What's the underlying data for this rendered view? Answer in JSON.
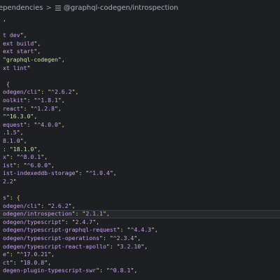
{
  "breadcrumb": {
    "first": "ependencies",
    "separator": ">",
    "second": "@graphql-codegen/introspection",
    "second_icon": "list-icon"
  },
  "code_lines": [
    {
      "text": ","
    },
    {
      "text": ""
    },
    {
      "text": "t dev\","
    },
    {
      "text": "ext build\","
    },
    {
      "text": "ext start\","
    },
    {
      "text": "\"graphql-codegen\","
    },
    {
      "text": "xt lint\""
    },
    {
      "text": ""
    },
    {
      "text": " {"
    },
    {
      "text": "odegen/cli\": \"^2.6.2\","
    },
    {
      "text": "oolkit\": \"^1.8.1\","
    },
    {
      "text": "react\": \"^1.2.8\","
    },
    {
      "text": "\"^16.3.0\","
    },
    {
      "text": "equest\": \"^4.0.0\","
    },
    {
      "text": ".1.5\","
    },
    {
      "text": "8.1.0\","
    },
    {
      "text": ": \"18.1.0\","
    },
    {
      "text": "x\": \"^8.0.1\","
    },
    {
      "text": "ist\": \"^6.0.0\","
    },
    {
      "text": "ist-indexeddb-storage\": \"^1.0.4\","
    },
    {
      "text": "2.2\""
    },
    {
      "text": ""
    },
    {
      "text": "s\": {"
    },
    {
      "text": "odegen/cli\": \"2.6.2\","
    },
    {
      "text": "odegen/introspection\": \"2.1.1\","
    },
    {
      "text": "odegen/typescript\": \"2.4.7\","
    },
    {
      "text": "odegen/typescript-graphql-request\": \"^4.4.3\","
    },
    {
      "text": "odegen/typescript-operations\": \"^2.3.4\","
    },
    {
      "text": "odegen/typescript-react-apollo\": \"3.2.10\","
    },
    {
      "text": "e\": \"^17.0.21\","
    },
    {
      "text": "ct\": \"18.0.8\","
    },
    {
      "text": "degen-plugin-typescript-swr\": \"^0.8.1\","
    }
  ],
  "highlighted_line_index": 24
}
